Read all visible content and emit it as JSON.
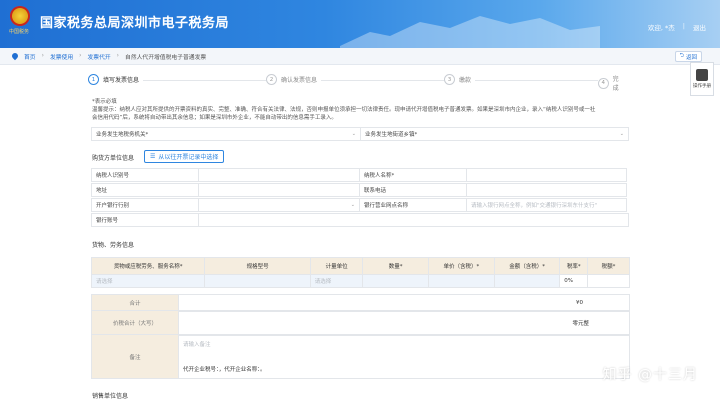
{
  "header": {
    "title": "国家税务总局深圳市电子税务局",
    "logo_text": "中国税务",
    "welcome": "欢迎",
    "user": "*杰",
    "logout": "退出"
  },
  "breadcrumb": {
    "home": "首页",
    "items": [
      "发票使用",
      "发票代开"
    ],
    "current": "自然人代开增值税电子普通发票"
  },
  "back_label": "返回",
  "side_tool_label": "操作手册",
  "steps": [
    {
      "num": "1",
      "label": "填写发票信息"
    },
    {
      "num": "2",
      "label": "确认发票信息"
    },
    {
      "num": "3",
      "label": "缴款"
    },
    {
      "num": "4",
      "label": "完成"
    }
  ],
  "note": {
    "required": "*表示必填",
    "line1": "温馨提示：纳税人应对其所提供的开票资料的真实、完整、准确、符合有关法律、法规，否则申报单位须承担一切法律责任。现申请代开增值税电子普通发票。如果是深圳市内企业，录入“纳税人识别号或一社",
    "line2": "会信用代码”后，系统将自动带出其余信息；如果是深圳市外企业，不能自动带出的信息需手工录入。"
  },
  "top_fields": {
    "org_label": "业务发生地税务机关*",
    "street_label": "业务发生地街道乡镇*"
  },
  "buyer": {
    "title": "购货方单位信息",
    "pick_label": "从以往开票记录中选择",
    "taxid_label": "纳税人识别号",
    "name_label": "纳税人名称*",
    "address_label": "地址",
    "phone_label": "联系电话",
    "bank_label": "开户银行行别",
    "branch_label": "银行营业网点名称",
    "branch_placeholder": "请输入银行网点全称，例如\"交通银行深圳东什支行\"",
    "account_label": "银行账号"
  },
  "goods": {
    "title": "货物、劳务信息",
    "headers": [
      "货物或应税劳务、服务名称*",
      "规格型号",
      "计量单位",
      "数量*",
      "单价（含税）*",
      "金额（含税）*",
      "税率*",
      "税额*"
    ],
    "row": [
      "请选择",
      "",
      "请选择",
      "",
      "",
      "",
      "0%",
      ""
    ],
    "total_label": "合计",
    "total_value": "¥0",
    "total_cn_label": "价税合计（大写）",
    "total_cn_value": "零元整",
    "remark_label": "备注",
    "remark_placeholder": "请输入备注",
    "remark_text": "代开企业税号：，代开企业名称：。"
  },
  "seller": {
    "title": "销售单位信息"
  },
  "watermark": "知乎 @十三月",
  "colors": {
    "brand": "#1f6fd3",
    "header_mid": "#2f86e0",
    "table_head": "#f5eddf",
    "input_fill": "#eef4fb"
  }
}
